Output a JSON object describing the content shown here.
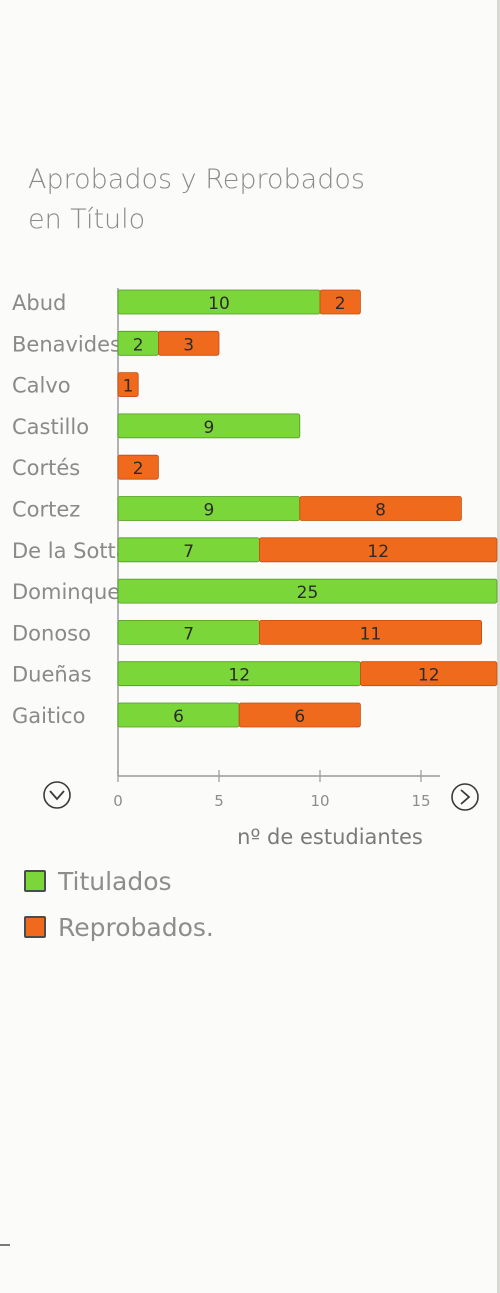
{
  "title_lines": [
    "Aprobados y Reprobados",
    "en Título"
  ],
  "colors": {
    "titulados": "#7bd63a",
    "reprobados": "#f06a1e"
  },
  "icons": {
    "down": "chevron-down-icon",
    "right": "chevron-right-icon"
  },
  "legend": [
    {
      "label": "Titulados",
      "color": "#7bd63a"
    },
    {
      "label": "Reprobados.",
      "color": "#f06a1e"
    }
  ],
  "chart_data": {
    "type": "bar",
    "orientation": "horizontal",
    "stacked": true,
    "categories": [
      "Abud",
      "Benavides",
      "Calvo",
      "Castillo",
      "Cortés",
      "Cortez",
      "De la Sotta",
      "Dominguez",
      "Donoso",
      "Dueñas",
      "Gaitico"
    ],
    "category_labels": [
      "Abud",
      "Benavides",
      "Calvo",
      "Castillo",
      "Cortés",
      "Cortez",
      "De la Sotta",
      "Dominques",
      "Donoso",
      "Dueñas",
      "Gaitico"
    ],
    "series": [
      {
        "name": "Titulados",
        "values": [
          10,
          2,
          0,
          9,
          0,
          9,
          7,
          25,
          7,
          12,
          6
        ]
      },
      {
        "name": "Reprobados.",
        "values": [
          2,
          3,
          1,
          0,
          2,
          8,
          12,
          0,
          11,
          12,
          6
        ]
      }
    ],
    "xlabel": "nº de estudiantes",
    "ylabel": "",
    "xticks": [
      0,
      5,
      10,
      15
    ],
    "xlim": [
      0,
      19
    ],
    "legend_position": "bottom-left"
  }
}
